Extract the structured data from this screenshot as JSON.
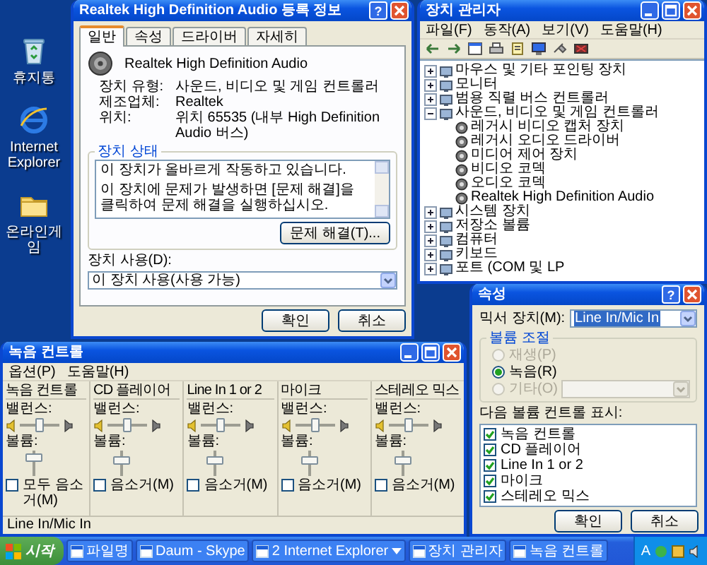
{
  "desktop_icons": [
    {
      "kind": "recycle_bin",
      "label": "휴지통"
    },
    {
      "kind": "browser",
      "label": "Internet Explorer"
    },
    {
      "kind": "folder",
      "label": "온라인게임"
    }
  ],
  "device_manager": {
    "title": "장치 관리자",
    "menu": [
      "파일(F)",
      "동작(A)",
      "보기(V)",
      "도움말(H)"
    ],
    "tree": [
      {
        "label": "마우스 및 기타 포인팅 장치",
        "expanded": false
      },
      {
        "label": "모니터",
        "expanded": false
      },
      {
        "label": "범용 직렬 버스 컨트롤러",
        "expanded": false
      },
      {
        "label": "사운드, 비디오 및 게임 컨트롤러",
        "expanded": true,
        "children": [
          {
            "label": "레거시 비디오 캡처 장치"
          },
          {
            "label": "레거시 오디오 드라이버"
          },
          {
            "label": "미디어 제어 장치"
          },
          {
            "label": "비디오 코덱"
          },
          {
            "label": "오디오 코덱"
          },
          {
            "label": "Realtek High Definition Audio"
          }
        ]
      },
      {
        "label": "시스템 장치",
        "expanded": false
      },
      {
        "label": "저장소 볼륨",
        "expanded": false
      },
      {
        "label": "컴퓨터",
        "expanded": false
      },
      {
        "label": "키보드",
        "expanded": false
      },
      {
        "label": "포트 (COM 및 LP",
        "expanded": false
      }
    ]
  },
  "realtek_properties": {
    "title": "Realtek High Definition Audio 등록 정보",
    "help_button": "?",
    "tabs": [
      {
        "label": "일반",
        "selected": true
      },
      {
        "label": "속성",
        "selected": false
      },
      {
        "label": "드라이버",
        "selected": false
      },
      {
        "label": "자세히",
        "selected": false
      }
    ],
    "device_name": "Realtek High Definition Audio",
    "properties": [
      {
        "label": "장치 유형:",
        "value": "사운드, 비디오 및 게임 컨트롤러"
      },
      {
        "label": "제조업체:",
        "value": "Realtek"
      },
      {
        "label": "위치:",
        "value": "위치 65535 (내부 High Definition Audio 버스)"
      }
    ],
    "status_group": {
      "title": "장치 상태",
      "lines": [
        "이 장치가 올바르게 작동하고 있습니다.",
        "이 장치에 문제가 발생하면 [문제 해결]을 클릭하여 문제 해결을 실행하십시오."
      ],
      "button": "문제 해결(T)..."
    },
    "usage": {
      "label": "장치 사용(D):",
      "value": "이 장치 사용(사용 가능)"
    },
    "buttons": [
      "확인",
      "취소"
    ]
  },
  "volume_properties": {
    "title": "속성",
    "help_button": "?",
    "mixer": {
      "label": "믹서 장치(M):",
      "value": "Line In/Mic In"
    },
    "group_title": "볼륨 조절",
    "radios": [
      {
        "label": "재생(P)",
        "selected": false,
        "disabled": true
      },
      {
        "label": "녹음(R)",
        "selected": true,
        "disabled": false
      },
      {
        "label": "기타(O)",
        "selected": false,
        "disabled": true
      }
    ],
    "list_label": "다음 볼륨 컨트롤 표시:",
    "controls": [
      {
        "label": "녹음 컨트롤",
        "checked": true
      },
      {
        "label": "CD 플레이어",
        "checked": true
      },
      {
        "label": "Line In 1 or 2",
        "checked": true
      },
      {
        "label": "마이크",
        "checked": true
      },
      {
        "label": "스테레오 믹스",
        "checked": true
      }
    ],
    "buttons": [
      "확인",
      "취소"
    ]
  },
  "recording_control": {
    "title": "녹음 컨트롤",
    "menu": [
      "옵션(P)",
      "도움말(H)"
    ],
    "channels": [
      {
        "name": "녹음 컨트롤",
        "balance": {
          "label": "밸런스:",
          "level": 0.5
        },
        "volume": {
          "label": "볼륨:",
          "level": 0.85
        },
        "mute": {
          "label": "모두 음소거(M)",
          "checked": false
        }
      },
      {
        "name": "CD 플레이어",
        "balance": {
          "label": "밸런스:",
          "level": 0.5
        },
        "volume": {
          "label": "볼륨:",
          "level": 0.7
        },
        "mute": {
          "label": "음소거(M)",
          "checked": false
        }
      },
      {
        "name": "Line In 1 or 2",
        "balance": {
          "label": "밸런스:",
          "level": 0.5
        },
        "volume": {
          "label": "볼륨:",
          "level": 0.7
        },
        "mute": {
          "label": "음소거(M)",
          "checked": false
        }
      },
      {
        "name": "마이크",
        "balance": {
          "label": "밸런스:",
          "level": 0.5
        },
        "volume": {
          "label": "볼륨:",
          "level": 0.7
        },
        "mute": {
          "label": "음소거(M)",
          "checked": false
        }
      },
      {
        "name": "스테레오 믹스",
        "balance": {
          "label": "밸런스:",
          "level": 0.5
        },
        "volume": {
          "label": "볼륨:",
          "level": 0.7
        },
        "mute": {
          "label": "음소거(M)",
          "checked": false
        }
      }
    ],
    "status_bar": "Line In/Mic In"
  },
  "taskbar": {
    "start": "시작",
    "buttons": [
      {
        "label": "파일명",
        "grouped": false
      },
      {
        "label": "Daum - Skype",
        "grouped": false
      },
      {
        "label": "2 Internet Explorer",
        "grouped": true
      },
      {
        "label": "장치 관리자",
        "grouped": false
      },
      {
        "label": "녹음 컨트롤",
        "grouped": false
      }
    ],
    "input_mode": "A"
  }
}
